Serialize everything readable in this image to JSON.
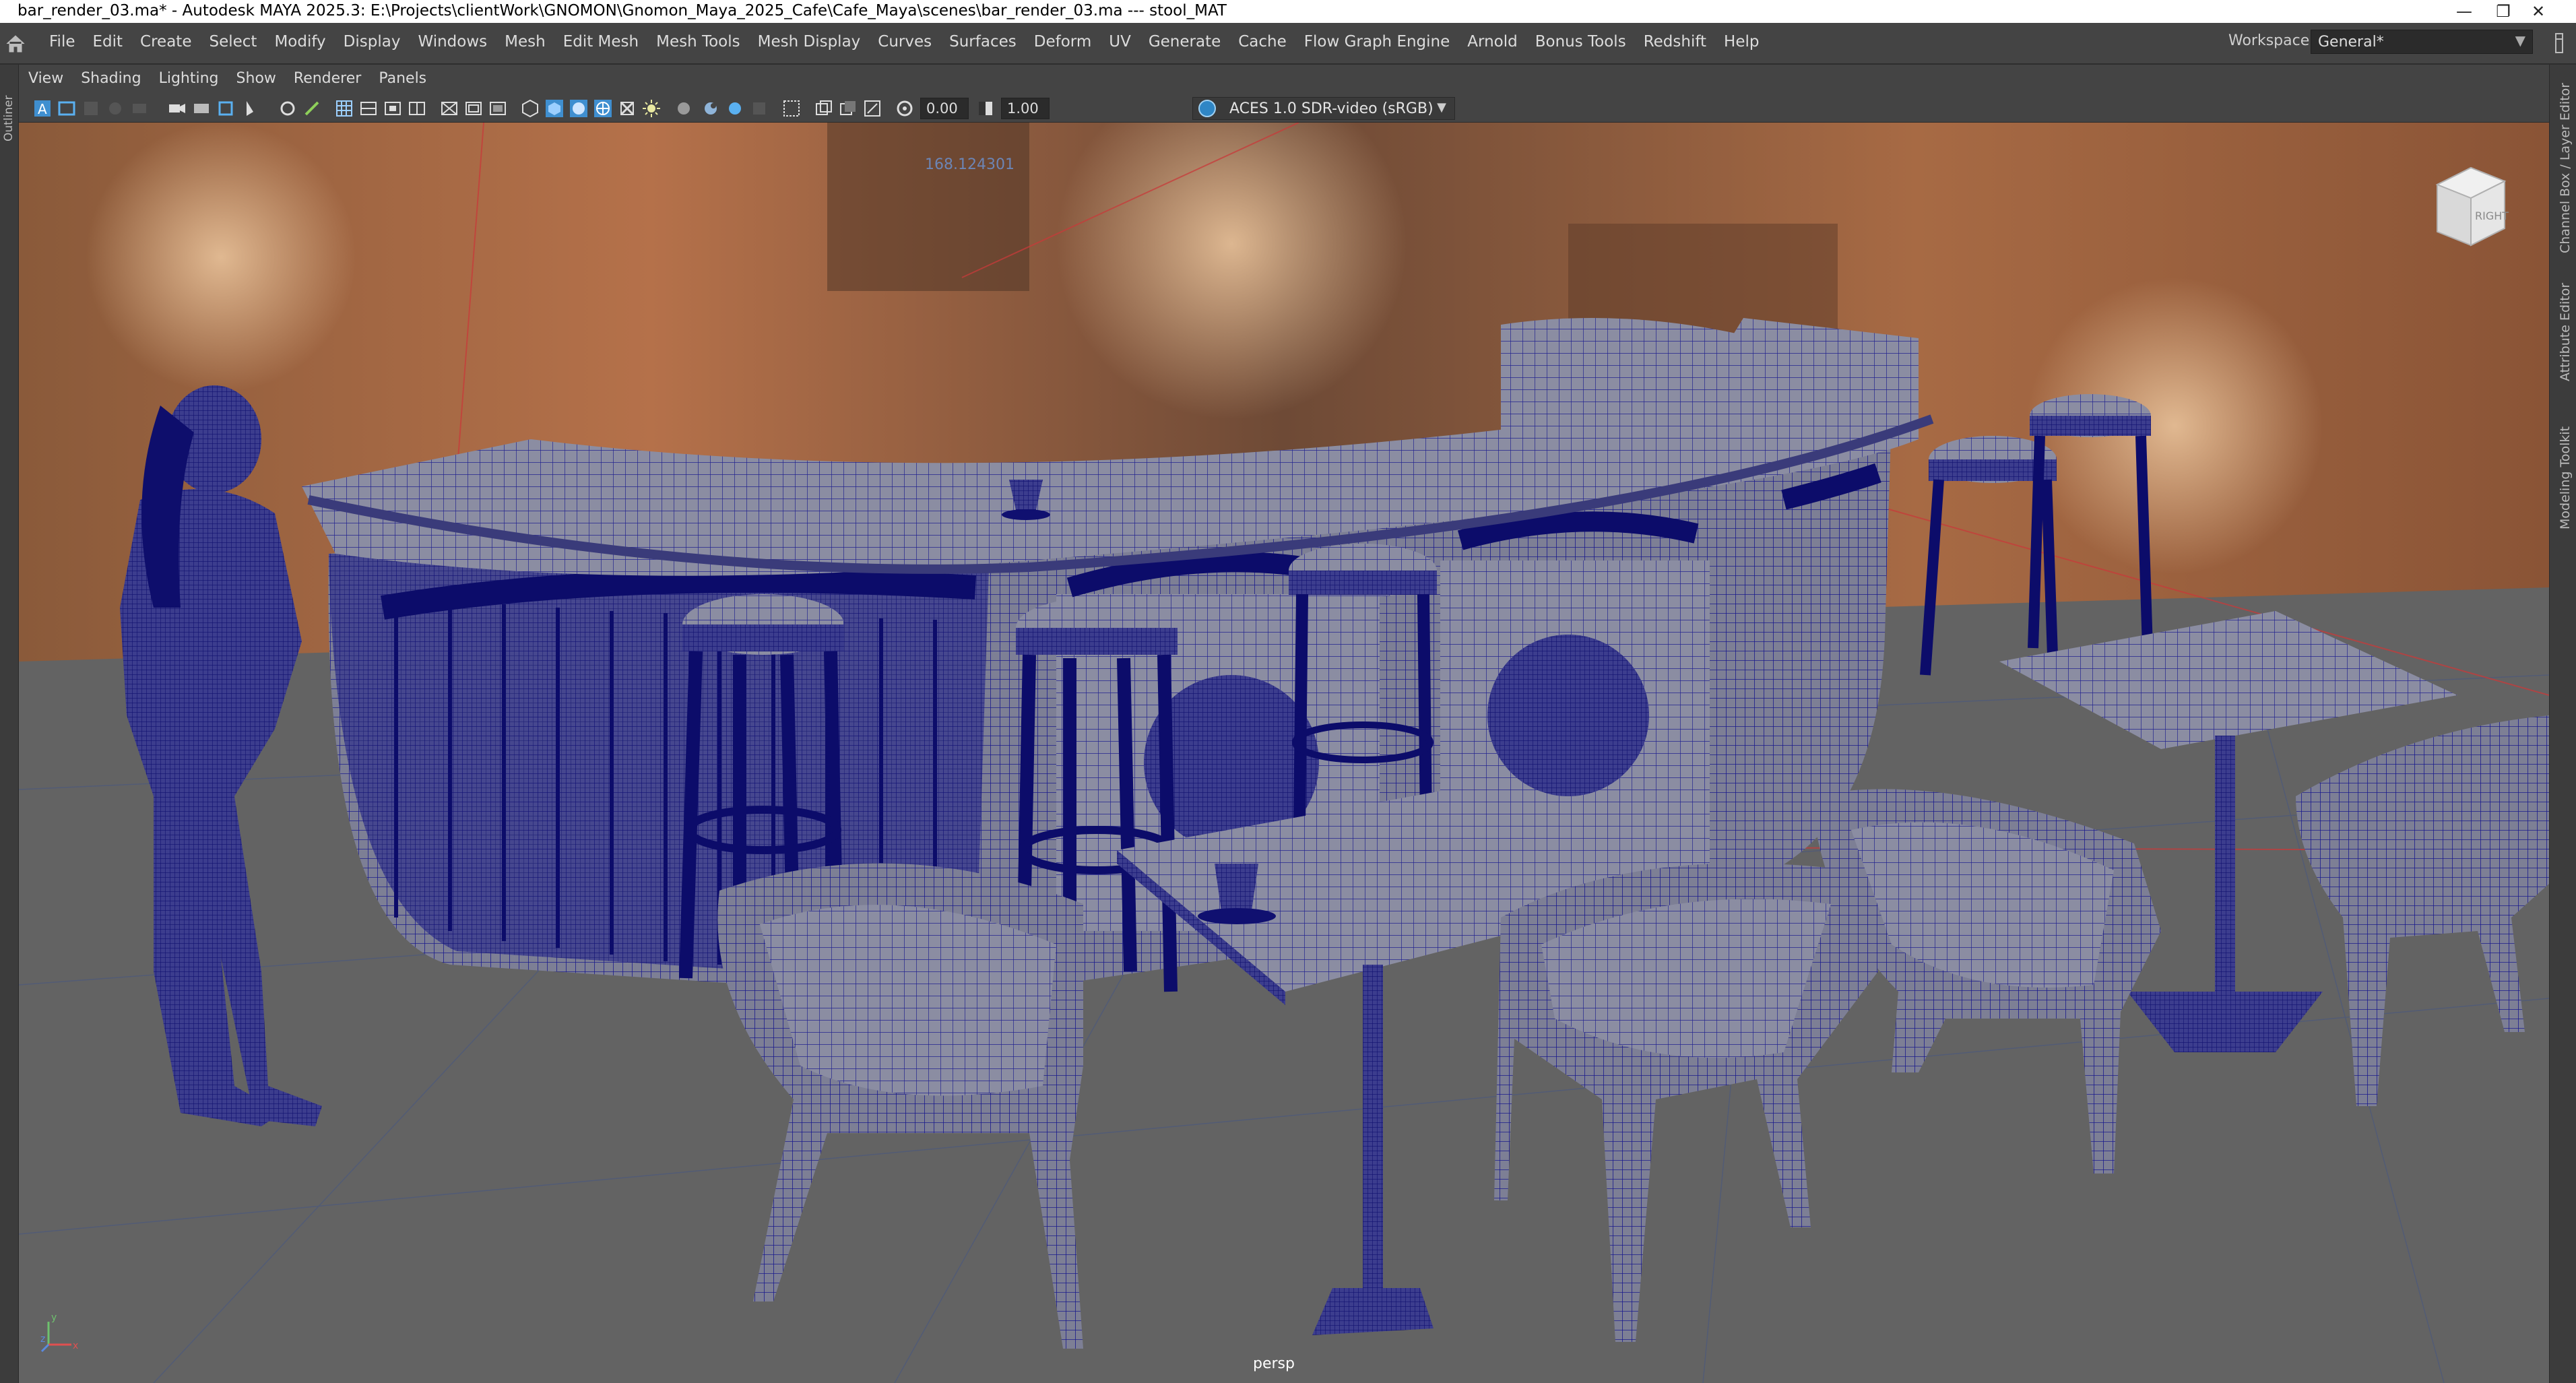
{
  "window": {
    "title": "bar_render_03.ma* - Autodesk MAYA 2025.3: E:\\Projects\\clientWork\\GNOMON\\Gnomon_Maya_2025_Cafe\\Cafe_Maya\\scenes\\bar_render_03.ma    ---    stool_MAT",
    "controls": [
      "minimize-icon",
      "restore-icon",
      "close-icon"
    ]
  },
  "menubar": {
    "items": [
      "File",
      "Edit",
      "Create",
      "Select",
      "Modify",
      "Display",
      "Windows",
      "Mesh",
      "Edit Mesh",
      "Mesh Tools",
      "Mesh Display",
      "Curves",
      "Surfaces",
      "Deform",
      "UV",
      "Generate",
      "Cache",
      "Flow Graph Engine",
      "Arnold",
      "Bonus Tools",
      "Redshift",
      "Help"
    ],
    "workspace_label": "Workspace:",
    "workspace_value": "General*"
  },
  "panel_menu": {
    "items": [
      "View",
      "Shading",
      "Lighting",
      "Show",
      "Renderer",
      "Panels"
    ]
  },
  "toolbar": {
    "exposure_value": "0.00",
    "gamma_value": "1.00",
    "color_space": "ACES 1.0 SDR-video (sRGB)",
    "icons": [
      "select-camera-icon",
      "camera-attributes-icon",
      "bookmark-icon",
      "image-plane-icon",
      "grid-icon",
      "film-gate-icon",
      "resolution-gate-icon",
      "gate-mask-icon",
      "field-chart-icon",
      "safe-action-icon",
      "safe-title-icon",
      "wireframe-icon",
      "smooth-shade-icon",
      "default-material-icon",
      "wireframe-on-shaded-icon",
      "textured-icon",
      "lighting-icon",
      "shadows-icon",
      "screen-space-ao-icon",
      "motion-blur-icon",
      "multisample-aa-icon",
      "depth-of-field-icon",
      "isolate-select-icon",
      "xray-icon",
      "xray-joints-icon",
      "backface-culling-icon",
      "exposure-icon",
      "gamma-icon",
      "color-management-icon"
    ]
  },
  "side_panels": {
    "left": "Outliner",
    "right": [
      "Channel Box / Layer Editor",
      "Attribute Editor",
      "Modeling Toolkit"
    ]
  },
  "viewport": {
    "coord_readout": "168.124301",
    "camera_label": "persp",
    "viewcube_face": "RIGHT",
    "axis_labels": [
      "y",
      "z",
      "x"
    ],
    "wire_color": "#1a1a8c",
    "ground_color": "#636363"
  }
}
